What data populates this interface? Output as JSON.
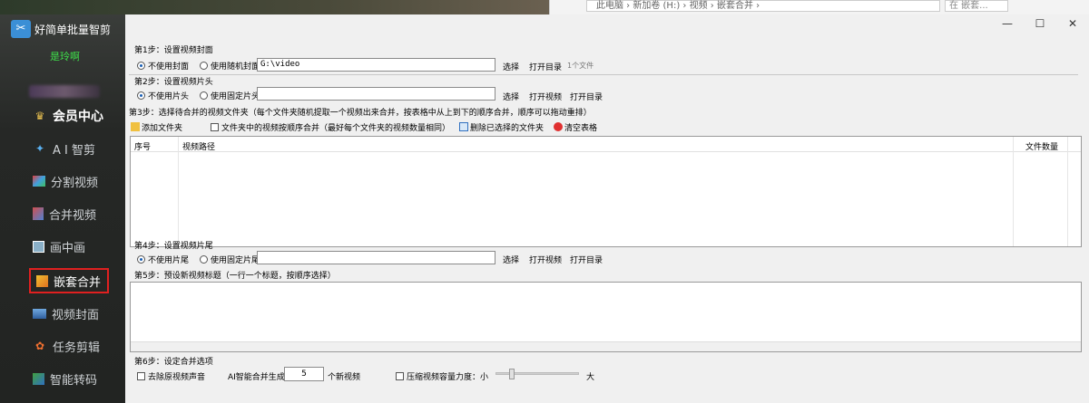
{
  "explorer": {
    "address": "此电脑 › 新加卷 (H:) › 视频 › 嵌套合并 ›",
    "search": "在 嵌套..."
  },
  "app": {
    "title": "好简单批量智剪",
    "user_name": "是玲啊"
  },
  "sidebar": {
    "items": [
      {
        "label": "会员中心",
        "icon": "member-icon"
      },
      {
        "label": "A I 智剪",
        "icon": "ai-icon"
      },
      {
        "label": "分割视频",
        "icon": "split-icon"
      },
      {
        "label": "合并视频",
        "icon": "merge-icon"
      },
      {
        "label": "画中画",
        "icon": "pip-icon"
      },
      {
        "label": "嵌套合并",
        "icon": "nest-icon"
      },
      {
        "label": "视频封面",
        "icon": "cover-icon"
      },
      {
        "label": "任务剪辑",
        "icon": "task-icon"
      },
      {
        "label": "智能转码",
        "icon": "transcode-icon"
      }
    ]
  },
  "window": {
    "minimize": "—",
    "maximize": "☐",
    "close": "✕"
  },
  "step1": {
    "title": "第1步：设置视频封面",
    "opt_none": "不使用封面",
    "opt_random": "使用随机封面",
    "path": "G:\\video",
    "select": "选择",
    "open_dir": "打开目录",
    "count": "1个文件"
  },
  "step2": {
    "title": "第2步：设置视频片头",
    "opt_none": "不使用片头",
    "opt_fixed": "使用固定片头",
    "path": "",
    "select": "选择",
    "open_video": "打开视频",
    "open_dir": "打开目录"
  },
  "step3": {
    "title": "第3步：选择待合并的视频文件夹（每个文件夹随机提取一个视频出来合并，按表格中从上到下的顺序合并，顺序可以拖动重排）",
    "add_folder": "添加文件夹",
    "order_check": "文件夹中的视频按顺序合并（最好每个文件夹的视频数量相同）",
    "delete_selected": "删除已选择的文件夹",
    "clear_table": "清空表格",
    "columns": [
      "序号",
      "视频路径",
      "文件数量"
    ]
  },
  "step4": {
    "title": "第4步：设置视频片尾",
    "opt_none": "不使用片尾",
    "opt_fixed": "使用固定片尾",
    "path": "",
    "select": "选择",
    "open_video": "打开视频",
    "open_dir": "打开目录"
  },
  "step5": {
    "title": "第5步：预设新视频标题（一行一个标题，按顺序选择）"
  },
  "step6": {
    "title": "第6步：设定合并选项",
    "remove_audio": "去除原视频声音",
    "ai_label": "AI智能合并生成:",
    "ai_count": "5",
    "ai_suffix": "个新视频",
    "compress": "压缩视频容量",
    "strength": "力度：小",
    "big": "大"
  }
}
